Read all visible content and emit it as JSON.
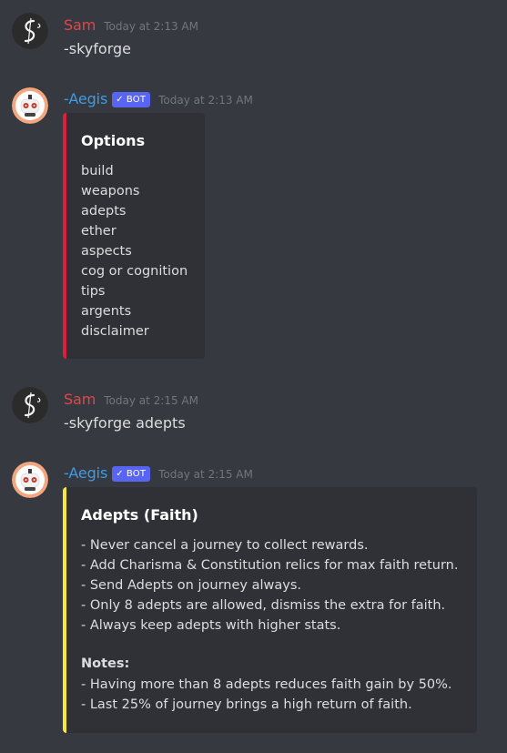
{
  "messages": [
    {
      "author": "Sam",
      "timestamp": "Today at 2:13 AM",
      "text": "-skyforge"
    },
    {
      "author": "-Aegis",
      "bot_tag": "BOT",
      "timestamp": "Today at 2:13 AM",
      "embed": {
        "accent_color": "#e01e3c",
        "title": "Options",
        "lines": [
          "build",
          "weapons",
          "adepts",
          "ether",
          "aspects",
          "cog or cognition",
          "tips",
          "argents",
          "disclaimer"
        ]
      }
    },
    {
      "author": "Sam",
      "timestamp": "Today at 2:15 AM",
      "text": "-skyforge adepts"
    },
    {
      "author": "-Aegis",
      "bot_tag": "BOT",
      "timestamp": "Today at 2:15 AM",
      "embed": {
        "accent_color": "#f5e73b",
        "title": "Adepts (Faith)",
        "lines": [
          "- Never cancel a journey to collect rewards.",
          "- Add Charisma & Constitution relics for max faith return.",
          "- Send Adepts on journey always.",
          "- Only 8 adepts are allowed, dismiss the extra for faith.",
          "- Always keep adepts with higher stats."
        ],
        "notes_title": "Notes:",
        "notes": [
          "- Having more than 8 adepts reduces faith gain by 50%.",
          "- Last 25% of journey brings a high return of faith."
        ]
      }
    }
  ],
  "colors": {
    "background": "#36393f",
    "embed_background": "#2f3136",
    "sam_name": "#e0464a",
    "bot_name": "#3f9be6",
    "bot_tag": "#5865f2"
  },
  "icons": {
    "sam_avatar": "swirl-logo-avatar",
    "bot_avatar": "robot-avatar",
    "bot_verified": "checkmark-icon"
  }
}
